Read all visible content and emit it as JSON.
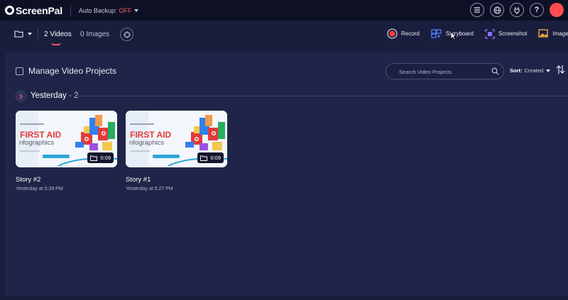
{
  "app": {
    "name": "ScreenPal",
    "backup_label": "Auto Backup:",
    "backup_state": "OFF"
  },
  "top_icons": [
    "menu-icon",
    "globe-icon",
    "plug-icon",
    "help-icon"
  ],
  "avatar_text": "",
  "toolbar": {
    "tab_videos": "2 Videos",
    "tab_images": "0 Images",
    "actions": [
      {
        "label": "Record",
        "icon": "record-icon"
      },
      {
        "label": "Storyboard",
        "icon": "storyboard-icon"
      },
      {
        "label": "Screenshot",
        "icon": "screenshot-icon"
      },
      {
        "label": "Image",
        "icon": "image-icon"
      }
    ]
  },
  "main": {
    "manage_label": "Manage Video Projects",
    "search_placeholder": "Search Video Projects",
    "sort_label": "Sort:",
    "sort_value": "Created",
    "group": {
      "name": "Yesterday",
      "count": "- 2"
    }
  },
  "projects": [
    {
      "title": "Story #2",
      "time": "Yesterday at 5:39 PM",
      "duration": "0:09",
      "thumb_text_1": "FIRST AID",
      "thumb_text_2": "nfographics"
    },
    {
      "title": "Story #1",
      "time": "Yesterday at 5:27 PM",
      "duration": "0:09",
      "thumb_text_1": "FIRST AID",
      "thumb_text_2": "nfographics"
    }
  ],
  "colors": {
    "accent": "#ff4d6d",
    "record": "#ff3b3b",
    "storyboard": "#4f7dff",
    "screenshot": "#8a6dff",
    "image": "#ffb347"
  }
}
